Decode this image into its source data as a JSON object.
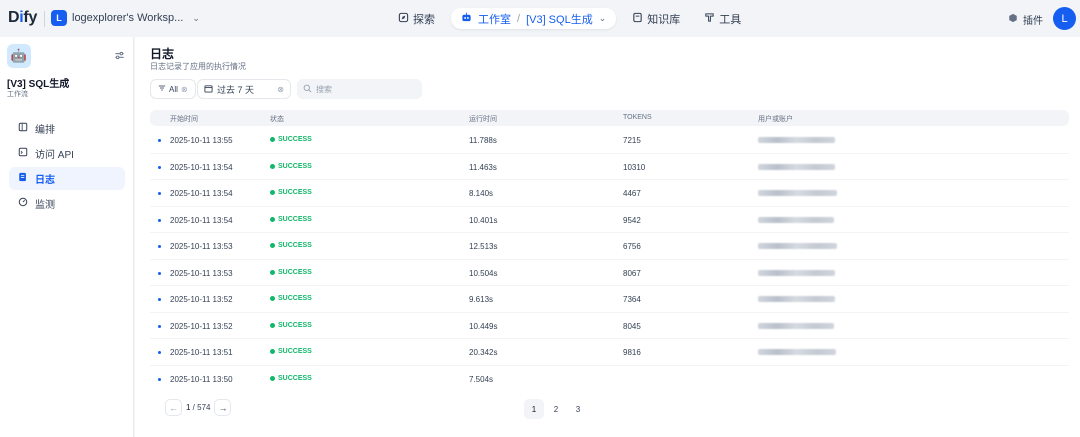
{
  "brand": {
    "logo_text": "Dify"
  },
  "workspace": {
    "badge": "L",
    "name": "logexplorer's Worksp..."
  },
  "nav": {
    "explore": "探索",
    "studio": "工作室",
    "current_app": "[V3] SQL生成",
    "knowledge": "知识库",
    "tools": "工具"
  },
  "header_right": {
    "plugins": "插件",
    "avatar": "L"
  },
  "app": {
    "name": "[V3] SQL生成",
    "type": "工作流",
    "icon": "🤖"
  },
  "sidebar": {
    "items": [
      {
        "label": "编排",
        "icon": "layout-icon"
      },
      {
        "label": "访问 API",
        "icon": "terminal-icon"
      },
      {
        "label": "日志",
        "icon": "document-icon",
        "active": true
      },
      {
        "label": "监测",
        "icon": "gauge-icon"
      }
    ]
  },
  "page": {
    "title": "日志",
    "subtitle": "日志记录了应用的执行情况"
  },
  "filters": {
    "status": "All",
    "period": "过去 7 天",
    "search_placeholder": "搜索"
  },
  "table": {
    "headers": [
      "开始时间",
      "状态",
      "运行时间",
      "TOKENS",
      "用户或账户"
    ],
    "rows": [
      {
        "start": "2025-10-11 13:55",
        "status": "SUCCESS",
        "runtime": "11.788s",
        "tokens": "7215"
      },
      {
        "start": "2025-10-11 13:54",
        "status": "SUCCESS",
        "runtime": "11.463s",
        "tokens": "10310"
      },
      {
        "start": "2025-10-11 13:54",
        "status": "SUCCESS",
        "runtime": "8.140s",
        "tokens": "4467"
      },
      {
        "start": "2025-10-11 13:54",
        "status": "SUCCESS",
        "runtime": "10.401s",
        "tokens": "9542"
      },
      {
        "start": "2025-10-11 13:53",
        "status": "SUCCESS",
        "runtime": "12.513s",
        "tokens": "6756"
      },
      {
        "start": "2025-10-11 13:53",
        "status": "SUCCESS",
        "runtime": "10.504s",
        "tokens": "8067"
      },
      {
        "start": "2025-10-11 13:52",
        "status": "SUCCESS",
        "runtime": "9.613s",
        "tokens": "7364"
      },
      {
        "start": "2025-10-11 13:52",
        "status": "SUCCESS",
        "runtime": "10.449s",
        "tokens": "8045"
      },
      {
        "start": "2025-10-11 13:51",
        "status": "SUCCESS",
        "runtime": "20.342s",
        "tokens": "9816"
      },
      {
        "start": "2025-10-11 13:50",
        "status": "SUCCESS",
        "runtime": "7.504s",
        "tokens": ""
      }
    ]
  },
  "pagination": {
    "current": "1",
    "total": "574",
    "pages": [
      "1",
      "2",
      "3"
    ]
  },
  "colors": {
    "accent": "#155eef",
    "success": "#12b76a"
  }
}
